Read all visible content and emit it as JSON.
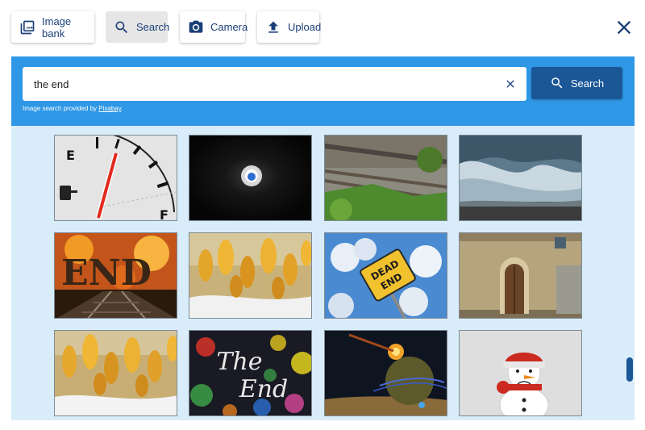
{
  "toolbar": {
    "image_bank_label": "Image bank",
    "search_label": "Search",
    "camera_label": "Camera",
    "upload_label": "Upload",
    "active_tab": "search"
  },
  "search": {
    "value": "the end",
    "submit_label": "Search",
    "provider_text": "Image search provided by ",
    "provider_link": "Pixabay",
    "provider_suffix": "."
  },
  "colors": {
    "accent": "#2e97e6",
    "primary": "#1b5797",
    "panel": "#d9ecfa",
    "label": "#1a3f78"
  },
  "icons": {
    "image_bank": "image-bank-icon",
    "search": "magnifier-icon",
    "camera": "camera-icon",
    "upload": "upload-icon",
    "close": "close-icon",
    "clear": "clear-icon"
  },
  "results": [
    {
      "subject": "fuel-gauge-on-empty"
    },
    {
      "subject": "tunnel-light"
    },
    {
      "subject": "railway-tracks"
    },
    {
      "subject": "stormy-sea"
    },
    {
      "subject": "end-sign-on-fire"
    },
    {
      "subject": "yellow-crocuses-in-snow"
    },
    {
      "subject": "dead-end-sign"
    },
    {
      "subject": "old-stone-door"
    },
    {
      "subject": "yellow-crocuses-in-snow"
    },
    {
      "subject": "the-end-bokeh"
    },
    {
      "subject": "planet-explosion"
    },
    {
      "subject": "sad-snowman"
    }
  ]
}
